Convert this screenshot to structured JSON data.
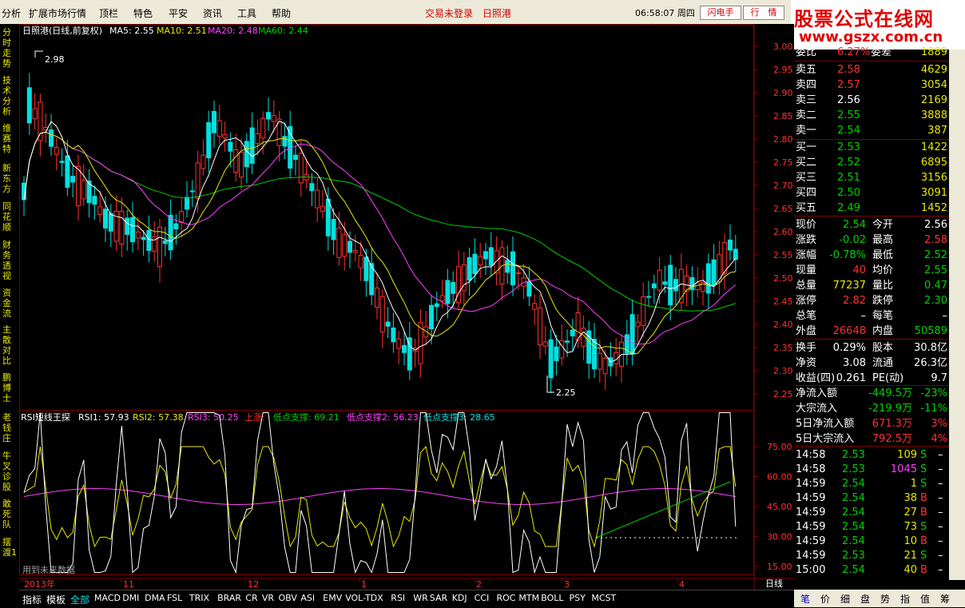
{
  "menu": {
    "items": [
      "分析",
      "扩展市场行情",
      "顶栏",
      "特色",
      "平安",
      "资讯",
      "工具",
      "帮助"
    ],
    "login": "交易未登录",
    "stock": "日照港",
    "time": "06:58:07",
    "weekday": "周四",
    "btn1": "闪电手",
    "btn2": "行　情"
  },
  "brand": {
    "t1": "股票公式在线网",
    "t2": "www.gszx.com.cn"
  },
  "leftnav": [
    "分时走势",
    "技术分析",
    "维赛特",
    "新东方",
    "同花顺",
    "财务透视",
    "资金流",
    "主散对比",
    "鹏博士",
    "老钱庄",
    "牛叉诊股",
    "敢死队",
    "摆渡1"
  ],
  "main": {
    "title": "日照港(日线,前复权)",
    "ma": [
      {
        "label": "MA5: 2.55",
        "color": "#ffffff"
      },
      {
        "label": "MA10: 2.51",
        "color": "#e8e800"
      },
      {
        "label": "MA20: 2.48",
        "color": "#ff40ff"
      },
      {
        "label": "MA60: 2.44",
        "color": "#00d000"
      }
    ],
    "yticks": [
      "3.00",
      "2.95",
      "2.90",
      "2.85",
      "2.80",
      "2.75",
      "2.70",
      "2.65",
      "2.60",
      "2.55",
      "2.50",
      "2.45",
      "2.40",
      "2.35",
      "2.30",
      "2.25"
    ],
    "high_label": "2.98",
    "low_label": "2.25"
  },
  "sub": {
    "title": "RSI短线王探",
    "items": [
      {
        "label": "RSI1: 57.93",
        "color": "#ffffff"
      },
      {
        "label": "RSI2: 57.38",
        "color": "#e8e800"
      },
      {
        "label": "RSI3: 50.25",
        "color": "#ff40ff"
      },
      {
        "label": "上涨:",
        "color": "#ff3030"
      },
      {
        "label": "低点支撑: 69.21",
        "color": "#00d000"
      },
      {
        "label": "低点支撑2: 56.23",
        "color": "#ff40ff"
      },
      {
        "label": "低点支撑3: 28.65",
        "color": "#00e0e0"
      }
    ],
    "yticks": [
      "75.00",
      "60.00",
      "45.00",
      "30.00",
      "15.00"
    ],
    "note": "用到未来数据"
  },
  "xaxis": [
    "2013年",
    "11",
    "12",
    "1",
    "2",
    "3",
    "4"
  ],
  "xaxis_right": "日线",
  "bottom": [
    "指标",
    "模板",
    "全部",
    "MACD",
    "DMI",
    "DMA",
    "FSL",
    "TRIX",
    "BRAR",
    "CR",
    "VR",
    "OBV",
    "ASI",
    "EMV",
    "VOL-TDX",
    "RSI",
    "WR",
    "SAR",
    "KDJ",
    "CCI",
    "ROC",
    "MTM",
    "BOLL",
    "PSY",
    "MCST"
  ],
  "rtabs": [
    "笔",
    "价",
    "细",
    "盘",
    "势",
    "指",
    "值",
    "筹"
  ],
  "quote": {
    "wb": {
      "l1": "委比",
      "v1": "6.27%",
      "l2": "委差",
      "v2": "1889"
    },
    "asks": [
      {
        "l": "卖五",
        "p": "2.58",
        "v": "4629",
        "c": "#ff3030"
      },
      {
        "l": "卖四",
        "p": "2.57",
        "v": "3054",
        "c": "#ff3030"
      },
      {
        "l": "卖三",
        "p": "2.56",
        "v": "2169",
        "c": "#ffffff"
      },
      {
        "l": "卖二",
        "p": "2.55",
        "v": "3888",
        "c": "#00d000"
      },
      {
        "l": "卖一",
        "p": "2.54",
        "v": "387",
        "c": "#00d000"
      }
    ],
    "bids": [
      {
        "l": "买一",
        "p": "2.53",
        "v": "1422",
        "c": "#00d000"
      },
      {
        "l": "买二",
        "p": "2.52",
        "v": "6895",
        "c": "#00d000"
      },
      {
        "l": "买三",
        "p": "2.51",
        "v": "3156",
        "c": "#00d000"
      },
      {
        "l": "买四",
        "p": "2.50",
        "v": "3091",
        "c": "#00d000"
      },
      {
        "l": "买五",
        "p": "2.49",
        "v": "1452",
        "c": "#00d000"
      }
    ],
    "stats": [
      {
        "l1": "现价",
        "v1": "2.54",
        "c1": "#00d000",
        "l2": "今开",
        "v2": "2.56",
        "c2": "#ffffff"
      },
      {
        "l1": "涨跌",
        "v1": "-0.02",
        "c1": "#00d000",
        "l2": "最高",
        "v2": "2.58",
        "c2": "#ff3030"
      },
      {
        "l1": "涨幅",
        "v1": "-0.78%",
        "c1": "#00d000",
        "l2": "最低",
        "v2": "2.52",
        "c2": "#00d000"
      },
      {
        "l1": "现量",
        "v1": "40",
        "c1": "#ff3030",
        "l2": "均价",
        "v2": "2.55",
        "c2": "#00d000"
      },
      {
        "l1": "总量",
        "v1": "77237",
        "c1": "#e8e800",
        "l2": "量比",
        "v2": "0.47",
        "c2": "#00d000"
      },
      {
        "l1": "涨停",
        "v1": "2.82",
        "c1": "#ff3030",
        "l2": "跌停",
        "v2": "2.30",
        "c2": "#00d000"
      },
      {
        "l1": "总笔",
        "v1": "–",
        "c1": "#ffffff",
        "l2": "每笔",
        "v2": "–",
        "c2": "#ffffff"
      },
      {
        "l1": "外盘",
        "v1": "26648",
        "c1": "#ff3030",
        "l2": "内盘",
        "v2": "50589",
        "c2": "#00d000"
      }
    ],
    "fin": [
      {
        "l1": "换手",
        "v1": "0.29%",
        "l2": "股本",
        "v2": "30.8亿"
      },
      {
        "l1": "净资",
        "v1": "3.08",
        "l2": "流通",
        "v2": "26.3亿"
      },
      {
        "l1": "收益(四)",
        "v1": "0.261",
        "l2": "PE(动)",
        "v2": "9.7"
      }
    ],
    "flow": [
      {
        "l": "净流入额",
        "v": "-449.5万",
        "p": "-23%",
        "c": "#00d000"
      },
      {
        "l": "大宗流入",
        "v": "-219.9万",
        "p": "-11%",
        "c": "#00d000"
      },
      {
        "l": "5日净流入额",
        "v": "671.3万",
        "p": "3%",
        "c": "#ff3030"
      },
      {
        "l": "5日大宗流入",
        "v": "792.5万",
        "p": "4%",
        "c": "#ff3030"
      }
    ],
    "ticks": [
      {
        "t": "14:58",
        "p": "2.53",
        "v": "109",
        "s": "S",
        "vc": "#e8e800",
        "sc": "#00d000"
      },
      {
        "t": "14:58",
        "p": "2.53",
        "v": "1045",
        "s": "S",
        "vc": "#ff40ff",
        "sc": "#00d000"
      },
      {
        "t": "14:59",
        "p": "2.54",
        "v": "1",
        "s": "S",
        "vc": "#e8e800",
        "sc": "#00d000"
      },
      {
        "t": "14:59",
        "p": "2.54",
        "v": "38",
        "s": "B",
        "vc": "#e8e800",
        "sc": "#ff3030"
      },
      {
        "t": "14:59",
        "p": "2.54",
        "v": "27",
        "s": "B",
        "vc": "#e8e800",
        "sc": "#ff3030"
      },
      {
        "t": "14:59",
        "p": "2.54",
        "v": "73",
        "s": "S",
        "vc": "#e8e800",
        "sc": "#00d000"
      },
      {
        "t": "14:59",
        "p": "2.54",
        "v": "10",
        "s": "B",
        "vc": "#e8e800",
        "sc": "#ff3030"
      },
      {
        "t": "14:59",
        "p": "2.53",
        "v": "21",
        "s": "S",
        "vc": "#e8e800",
        "sc": "#00d000"
      },
      {
        "t": "15:00",
        "p": "2.54",
        "v": "40",
        "s": "B",
        "vc": "#e8e800",
        "sc": "#ff3030"
      }
    ]
  },
  "colors": {
    "up": "#ff3030",
    "down": "#00e0e0",
    "grid": "#800000"
  }
}
